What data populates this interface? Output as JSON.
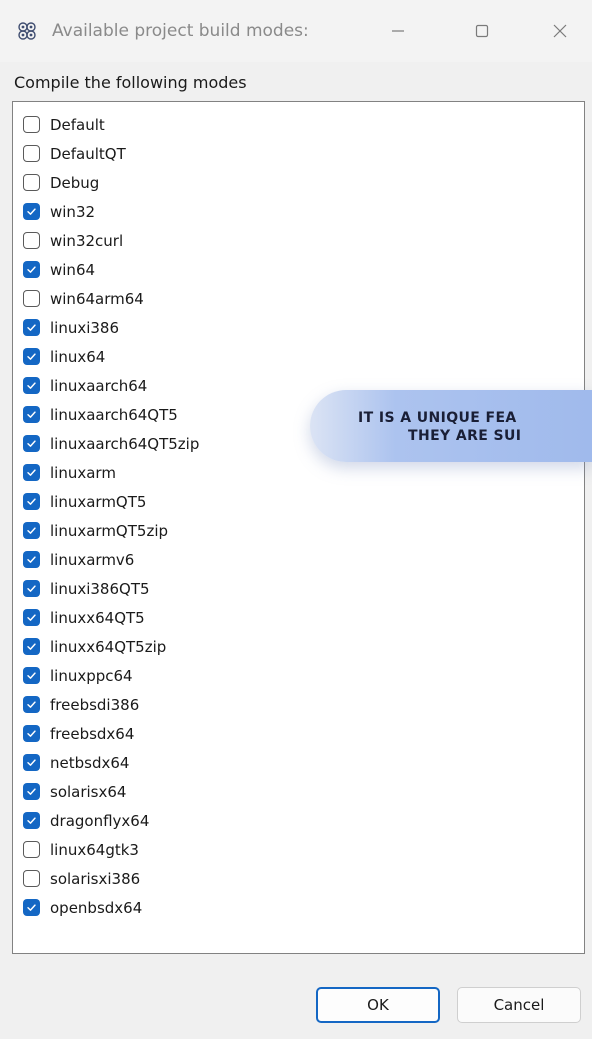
{
  "window": {
    "title": "Available project build modes:",
    "app_icon": "gear-cluster-icon",
    "controls": {
      "minimize": "minimize-icon",
      "maximize": "maximize-icon",
      "close": "close-icon"
    }
  },
  "section_label": "Compile the following modes",
  "modes": [
    {
      "label": "Default",
      "checked": false
    },
    {
      "label": "DefaultQT",
      "checked": false
    },
    {
      "label": "Debug",
      "checked": false
    },
    {
      "label": "win32",
      "checked": true
    },
    {
      "label": "win32curl",
      "checked": false
    },
    {
      "label": "win64",
      "checked": true
    },
    {
      "label": "win64arm64",
      "checked": false
    },
    {
      "label": "linuxi386",
      "checked": true
    },
    {
      "label": "linux64",
      "checked": true
    },
    {
      "label": "linuxaarch64",
      "checked": true
    },
    {
      "label": "linuxaarch64QT5",
      "checked": true
    },
    {
      "label": "linuxaarch64QT5zip",
      "checked": true
    },
    {
      "label": "linuxarm",
      "checked": true
    },
    {
      "label": "linuxarmQT5",
      "checked": true
    },
    {
      "label": "linuxarmQT5zip",
      "checked": true
    },
    {
      "label": "linuxarmv6",
      "checked": true
    },
    {
      "label": "linuxi386QT5",
      "checked": true
    },
    {
      "label": "linuxx64QT5",
      "checked": true
    },
    {
      "label": "linuxx64QT5zip",
      "checked": true
    },
    {
      "label": "linuxppc64",
      "checked": true
    },
    {
      "label": "freebsdi386",
      "checked": true
    },
    {
      "label": "freebsdx64",
      "checked": true
    },
    {
      "label": "netbsdx64",
      "checked": true
    },
    {
      "label": "solarisx64",
      "checked": true
    },
    {
      "label": "dragonflyx64",
      "checked": true
    },
    {
      "label": "linux64gtk3",
      "checked": false
    },
    {
      "label": "solarisxi386",
      "checked": false
    },
    {
      "label": "openbsdx64",
      "checked": true
    }
  ],
  "callout": {
    "line1": "IT IS A UNIQUE FEA",
    "line2": "THEY ARE SUI"
  },
  "buttons": {
    "ok": "OK",
    "cancel": "Cancel"
  },
  "colors": {
    "accent": "#1467c4",
    "list_background": "#ffffff",
    "window_background": "#f0f0f0",
    "callout": "#a0baec"
  }
}
